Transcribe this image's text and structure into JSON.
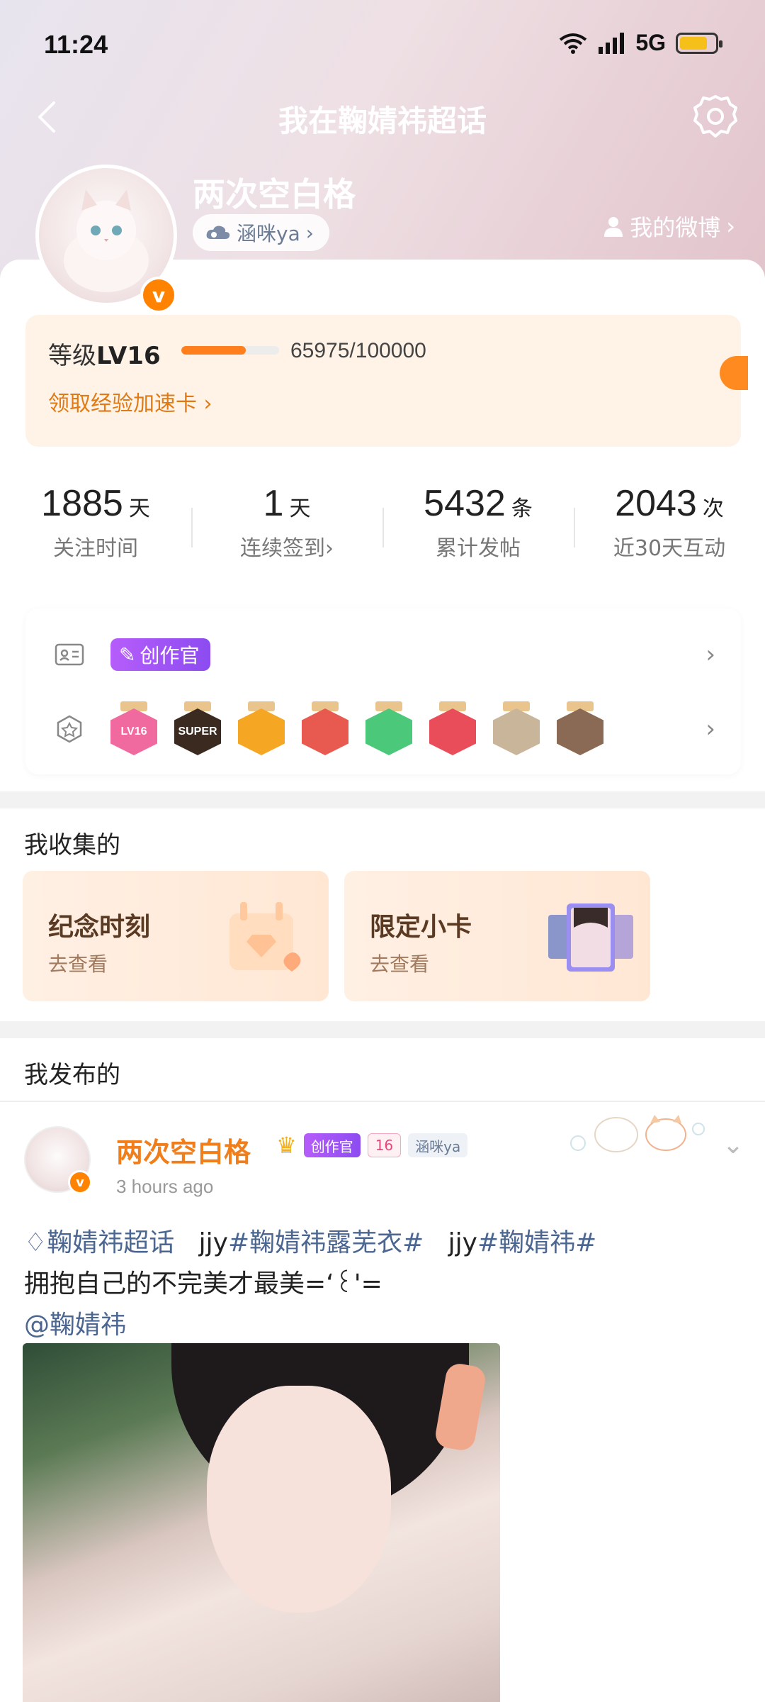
{
  "status_bar": {
    "time": "11:24",
    "network": "5G",
    "battery_level": 0.8
  },
  "nav": {
    "title": "我在鞠婧祎超话"
  },
  "profile": {
    "username": "两次空白格",
    "group_tag": "涵咪ya",
    "my_weibo": "我的微博",
    "verified_mark": "v"
  },
  "level": {
    "label": "等级",
    "value": "LV16",
    "exp_text": "65975/100000",
    "progress": 0.65975,
    "boost_link": "领取经验加速卡"
  },
  "stats": [
    {
      "num": "1885",
      "unit": "天",
      "label": "关注时间"
    },
    {
      "num": "1",
      "unit": "天",
      "label": "连续签到"
    },
    {
      "num": "5432",
      "unit": "条",
      "label": "累计发帖"
    },
    {
      "num": "2043",
      "unit": "次",
      "label": "近30天互动"
    }
  ],
  "honors": {
    "creator_tag": "创作官",
    "medal_icons": [
      "lv16-medal",
      "super-medal",
      "crown-medal",
      "girl-medal",
      "hand-medal",
      "trophy-medal",
      "idol-medal-1",
      "idol-medal-2"
    ],
    "medal_colors": [
      "#f06aa0",
      "#3b2a20",
      "#f5a623",
      "#e85a4f",
      "#4cc87a",
      "#ea4d5a",
      "#c9b59a",
      "#8a6a55"
    ],
    "medal_texts": [
      "LV16",
      "SUPER",
      "",
      "",
      "",
      "",
      "",
      ""
    ]
  },
  "collections": {
    "title": "我收集的",
    "items": [
      {
        "title": "纪念时刻",
        "sub": "去查看"
      },
      {
        "title": "限定小卡",
        "sub": "去查看"
      }
    ]
  },
  "posts_section": {
    "title": "我发布的"
  },
  "post": {
    "author": "两次空白格",
    "time": "3 hours ago",
    "tags": {
      "creator": "创作官",
      "level": "16",
      "group": "涵咪ya"
    },
    "topic1": "鞠婧祎超话",
    "prefix2": "jjy",
    "topic2": "#鞠婧祎露芜衣#",
    "prefix3": "jjy",
    "topic3": "#鞠婧祎#",
    "body": "拥抱自己的不完美才最美=ʻ꒰'=",
    "mention": "@鞠婧祎"
  }
}
